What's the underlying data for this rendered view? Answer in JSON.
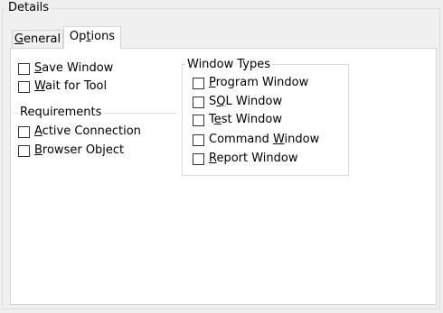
{
  "group": {
    "title": "Details"
  },
  "tabs": [
    {
      "label_pre": "",
      "label_ul": "G",
      "label_post": "eneral",
      "selected": false
    },
    {
      "label_pre": "Op",
      "label_ul": "t",
      "label_post": "ions",
      "selected": true
    }
  ],
  "options": {
    "top_checks": [
      {
        "pre": "",
        "ul": "S",
        "post": "ave Window",
        "checked": false
      },
      {
        "pre": "",
        "ul": "W",
        "post": "ait for Tool",
        "checked": false
      }
    ],
    "requirements": {
      "title": "Requirements",
      "checks": [
        {
          "pre": "",
          "ul": "A",
          "post": "ctive Connection",
          "checked": false
        },
        {
          "pre": "",
          "ul": "B",
          "post": "rowser Object",
          "checked": false
        }
      ]
    },
    "window_types": {
      "title": "Window Types",
      "checks": [
        {
          "pre": "",
          "ul": "P",
          "post": "rogram Window",
          "checked": false
        },
        {
          "pre": "S",
          "ul": "Q",
          "post": "L Window",
          "checked": false
        },
        {
          "pre": "T",
          "ul": "e",
          "post": "st Window",
          "checked": false
        },
        {
          "pre": "Command ",
          "ul": "W",
          "post": "indow",
          "checked": false
        },
        {
          "pre": "",
          "ul": "R",
          "post": "eport Window",
          "checked": false
        }
      ]
    }
  }
}
